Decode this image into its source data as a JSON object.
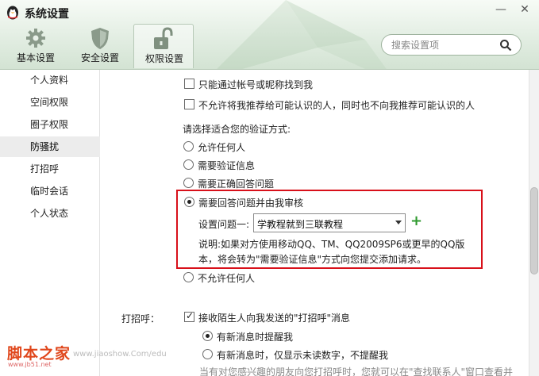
{
  "window": {
    "title": "系统设置",
    "minimize_label": "—",
    "close_label": "✕"
  },
  "tabs": [
    {
      "label": "基本设置",
      "icon": "gear-icon"
    },
    {
      "label": "安全设置",
      "icon": "shield-icon"
    },
    {
      "label": "权限设置",
      "icon": "unlock-icon",
      "active": true
    }
  ],
  "search": {
    "placeholder": "搜索设置项"
  },
  "sidebar": {
    "items": [
      {
        "label": "个人资料"
      },
      {
        "label": "空间权限"
      },
      {
        "label": "圈子权限"
      },
      {
        "label": "防骚扰",
        "active": true
      },
      {
        "label": "打招呼"
      },
      {
        "label": "临时会话"
      },
      {
        "label": "个人状态"
      }
    ]
  },
  "content": {
    "opt_only_account": "只能通过帐号或昵称找到我",
    "opt_no_recommend": "不允许将我推荐给可能认识的人，同时也不向我推荐可能认识的人",
    "verify_heading": "请选择适合您的验证方式:",
    "verify_options": [
      "允许任何人",
      "需要验证信息",
      "需要正确回答问题",
      "需要回答问题并由我审核",
      "不允许任何人"
    ],
    "verify_selected": "需要回答问题并由我审核",
    "question_label": "设置问题一:",
    "question_value": "学教程就到三联教程",
    "add_label": "+",
    "notice": "说明:如果对方使用移动QQ、TM、QQ2009SP6或更早的QQ版本，将会转为\"需要验证信息\"方式向您提交添加请求。",
    "greet_label": "打招呼：",
    "greet_checkbox": "接收陌生人向我发送的\"打招呼\"消息",
    "greet_options": [
      "有新消息时提醒我",
      "有新消息时，仅显示未读数字，不提醒我"
    ],
    "greet_selected": "有新消息时提醒我",
    "greet_note": "当有对您感兴趣的朋友向您打招呼时，您就可以在\"查找联系人\"窗口查看并"
  },
  "watermark": {
    "brand": "脚本之家",
    "url1": "www.jiaoshow.Com/edu",
    "url2": "www.jb51.net"
  },
  "colors": {
    "highlight_border": "#d8101a",
    "add_icon": "#2f9a2f",
    "header_green": "#d3e3d3"
  }
}
